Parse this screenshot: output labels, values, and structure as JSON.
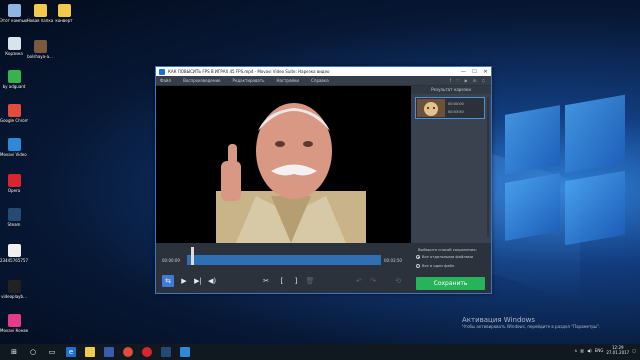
{
  "desktop": {
    "icons_left": [
      {
        "label": "Этот компьютер",
        "color": "#8fb6e0"
      },
      {
        "label": "Корзина",
        "color": "#d9e3ee"
      },
      {
        "label": "by adguard",
        "color": "#37b24d"
      },
      {
        "label": "Google Chrome",
        "color": "#e24c3c"
      },
      {
        "label": "Movavi Video Suite",
        "color": "#2e89d8"
      },
      {
        "label": "Opera",
        "color": "#d9252e"
      },
      {
        "label": "Steam",
        "color": "#264a73"
      },
      {
        "label": "23445765757",
        "color": "#f0f0f0"
      },
      {
        "label": "videoplayb...",
        "color": "#222222"
      },
      {
        "label": "Movavi Конверт...",
        "color": "#e23c8a"
      }
    ],
    "icons_col2": [
      {
        "label": "Новая папка",
        "color": "#f2c94c"
      },
      {
        "label": "bolshaya-a...",
        "color": "#7a5a3a"
      }
    ],
    "icons_col3": [
      {
        "label": "конверт",
        "color": "#f2c94c"
      }
    ]
  },
  "window": {
    "title": "КАК ПОВЫСИТЬ FPS В ИГРАХ 45 FPS.mp4 - Movavi Video Suite: Нарезка видео",
    "controls": [
      "—",
      "☐",
      "✕"
    ],
    "menu": [
      "Файл",
      "Воспроизведение",
      "Редактировать",
      "Настройки",
      "Справка"
    ],
    "social": [
      "f",
      "♡",
      "▶",
      "in",
      "♫"
    ]
  },
  "side_panel": {
    "title": "Результат нарезки",
    "clip": {
      "start": "00:00:00",
      "end": "00:03:50"
    }
  },
  "timeline": {
    "current": "00:00:09",
    "total": "00:03:50",
    "playhead_fraction": 0.02
  },
  "save": {
    "question": "Выберите способ сохранения:",
    "option1": "Все отдельными файлами",
    "option2": "Все в один файл",
    "button": "Сохранить"
  },
  "controls": [
    "⇆",
    "▶",
    "▶|",
    "◀)",
    "✂",
    "[",
    "]",
    "🗑",
    "↶",
    "↷",
    "⟲"
  ],
  "activation": {
    "line1": "Активация Windows",
    "line2": "Чтобы активировать Windows, перейдите в раздел \"Параметры\"."
  },
  "taskbar": {
    "time": "12:29",
    "date": "27.01.2017",
    "lang": "ENG"
  }
}
